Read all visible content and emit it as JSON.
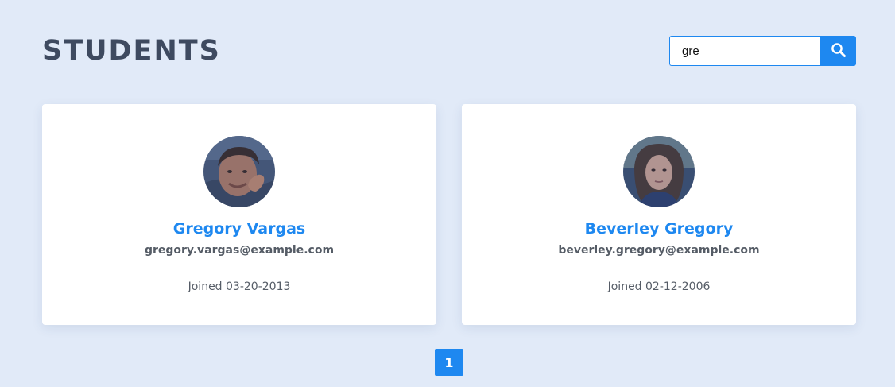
{
  "header": {
    "title": "STUDENTS"
  },
  "search": {
    "value": "gre",
    "button_icon": "search-icon"
  },
  "students": [
    {
      "name": "Gregory Vargas",
      "email": "gregory.vargas@example.com",
      "joined": "Joined 03-20-2013"
    },
    {
      "name": "Beverley Gregory",
      "email": "beverley.gregory@example.com",
      "joined": "Joined 02-12-2006"
    }
  ],
  "pagination": {
    "current_page": "1"
  },
  "colors": {
    "background": "#e1eaf8",
    "accent": "#1e88f0",
    "title": "#3e4a60",
    "text": "#555c66"
  }
}
